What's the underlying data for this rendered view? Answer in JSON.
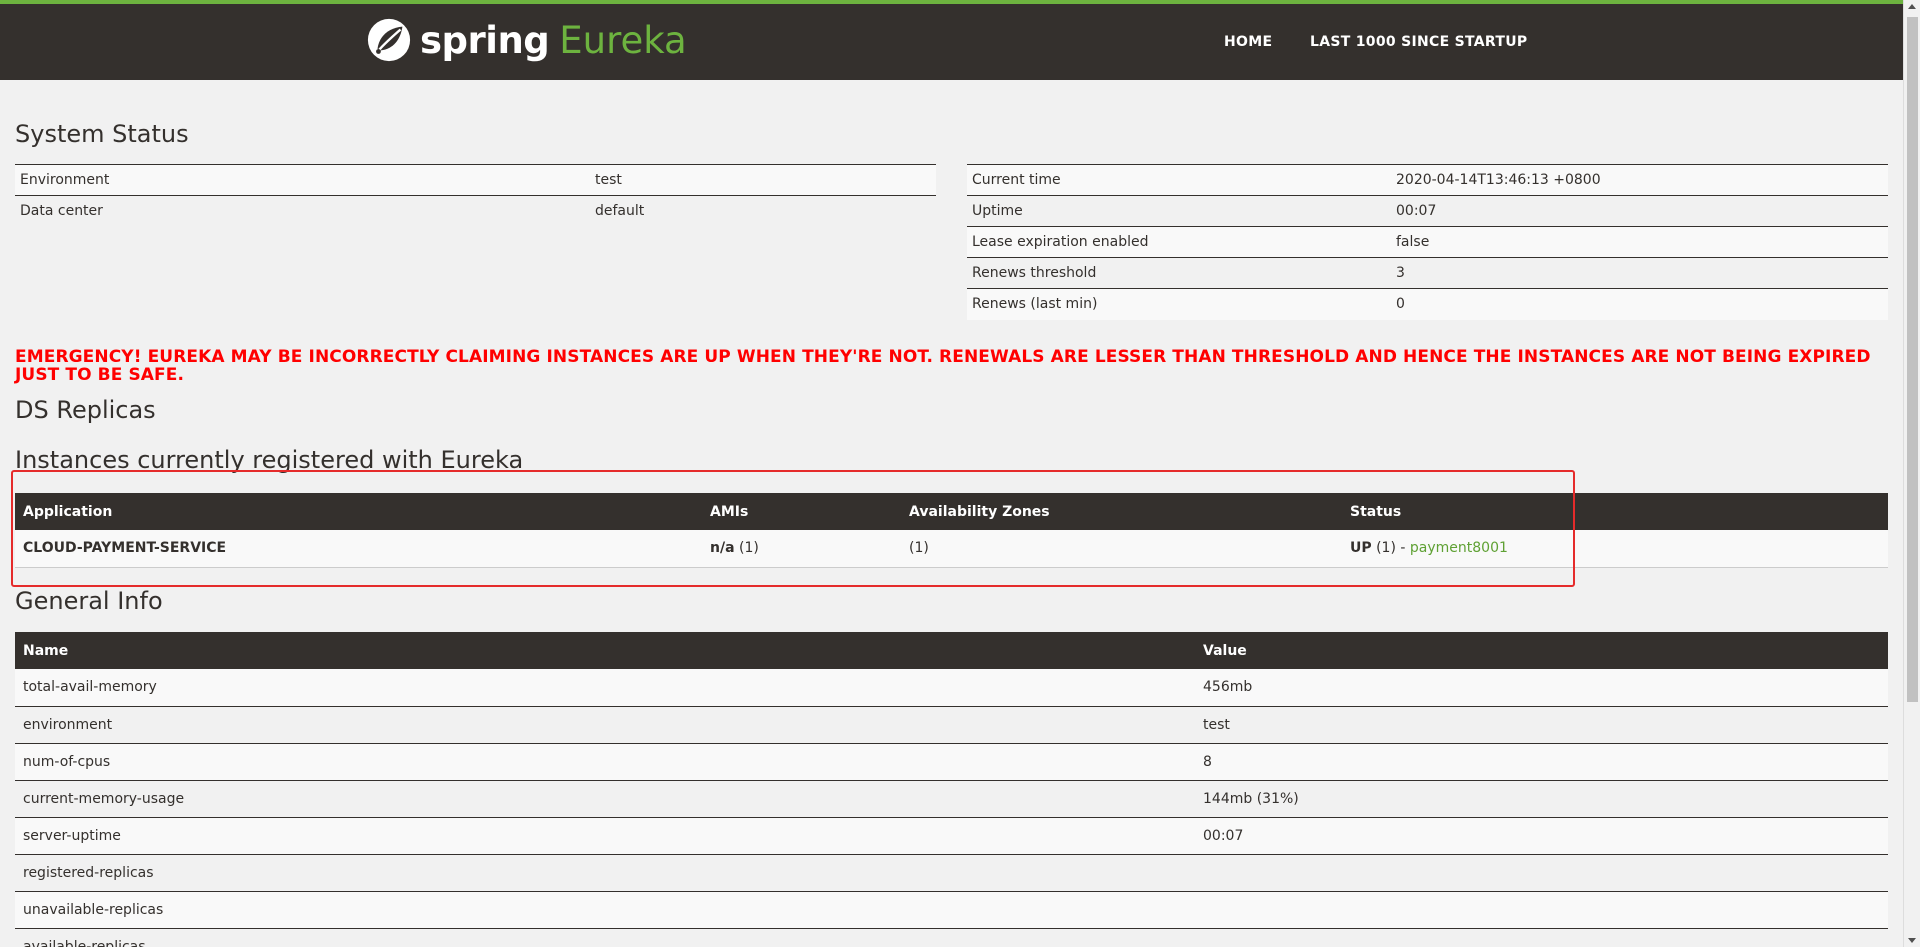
{
  "header": {
    "brand_main": "spring",
    "brand_sub": "Eureka",
    "nav": [
      "HOME",
      "LAST 1000 SINCE STARTUP"
    ],
    "accent": "#6db33f",
    "bg": "#34302d"
  },
  "system_status": {
    "title": "System Status",
    "left": [
      {
        "key": "Environment",
        "value": "test"
      },
      {
        "key": "Data center",
        "value": "default"
      }
    ],
    "right": [
      {
        "key": "Current time",
        "value": "2020-04-14T13:46:13 +0800"
      },
      {
        "key": "Uptime",
        "value": "00:07"
      },
      {
        "key": "Lease expiration enabled",
        "value": "false"
      },
      {
        "key": "Renews threshold",
        "value": "3"
      },
      {
        "key": "Renews (last min)",
        "value": "0"
      }
    ]
  },
  "emergency": "EMERGENCY! EUREKA MAY BE INCORRECTLY CLAIMING INSTANCES ARE UP WHEN THEY'RE NOT. RENEWALS ARE LESSER THAN THRESHOLD AND HENCE THE INSTANCES ARE NOT BEING EXPIRED JUST TO BE SAFE.",
  "ds_replicas": {
    "title": "DS Replicas"
  },
  "instances": {
    "title": "Instances currently registered with Eureka",
    "columns": [
      "Application",
      "AMIs",
      "Availability Zones",
      "Status"
    ],
    "rows": [
      {
        "application": "CLOUD-PAYMENT-SERVICE",
        "amis_bold": "n/a",
        "amis_count": "(1)",
        "zones": "(1)",
        "status_bold": "UP",
        "status_count": "(1) -",
        "status_link": "payment8001"
      }
    ]
  },
  "general_info": {
    "title": "General Info",
    "columns": [
      "Name",
      "Value"
    ],
    "rows": [
      {
        "name": "total-avail-memory",
        "value": "456mb"
      },
      {
        "name": "environment",
        "value": "test"
      },
      {
        "name": "num-of-cpus",
        "value": "8"
      },
      {
        "name": "current-memory-usage",
        "value": "144mb (31%)"
      },
      {
        "name": "server-uptime",
        "value": "00:07"
      },
      {
        "name": "registered-replicas",
        "value": ""
      },
      {
        "name": "unavailable-replicas",
        "value": ""
      },
      {
        "name": "available-replicas",
        "value": ""
      }
    ]
  }
}
